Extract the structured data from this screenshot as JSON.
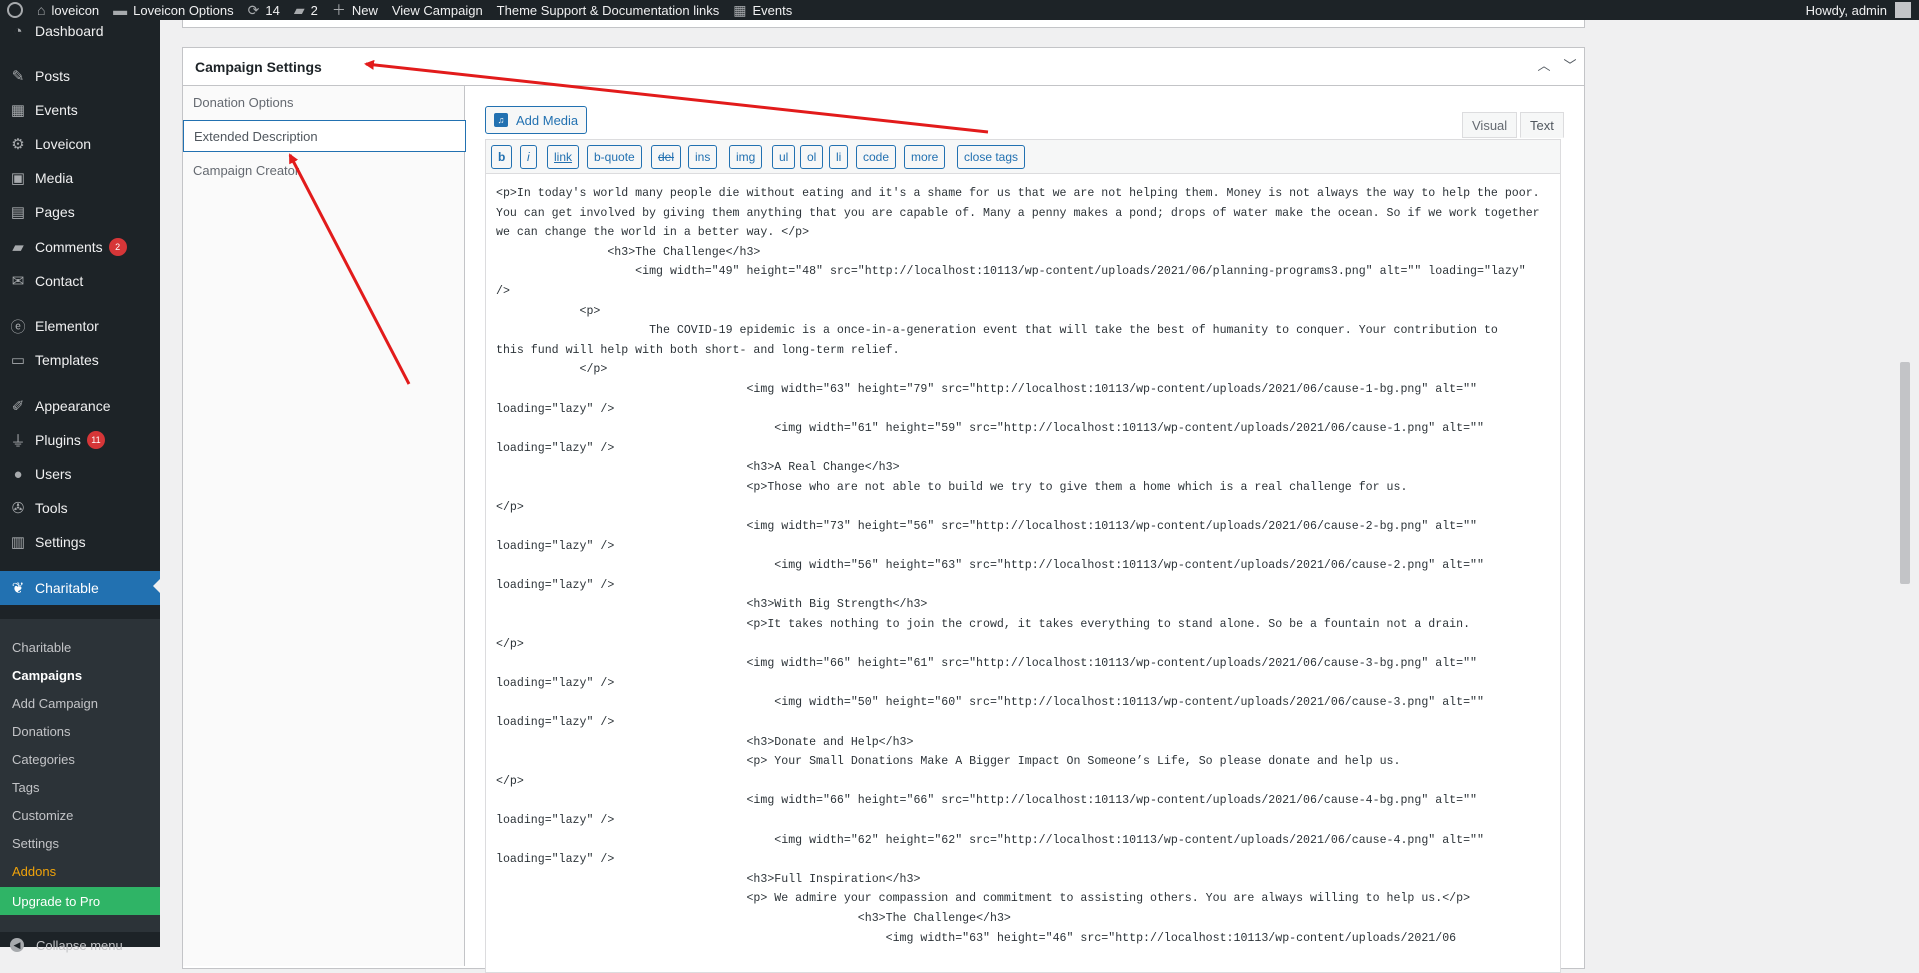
{
  "admin_bar": {
    "site_name": "loveicon",
    "options": "Loveicon Options",
    "updates_count": "14",
    "comments_count": "2",
    "new_label": "New",
    "view_campaign": "View Campaign",
    "theme_support": "Theme Support & Documentation links",
    "events": "Events",
    "howdy": "Howdy, admin"
  },
  "sidebar": {
    "items": [
      {
        "label": "Dashboard",
        "icon": "dashboard-icon"
      },
      {
        "label": "Posts",
        "icon": "pin-icon"
      },
      {
        "label": "Events",
        "icon": "calendar-icon"
      },
      {
        "label": "Loveicon",
        "icon": "gear-icon"
      },
      {
        "label": "Media",
        "icon": "media-icon"
      },
      {
        "label": "Pages",
        "icon": "page-icon"
      },
      {
        "label": "Comments",
        "icon": "comment-icon",
        "badge": "2"
      },
      {
        "label": "Contact",
        "icon": "mail-icon"
      },
      {
        "label": "Elementor",
        "icon": "elementor-icon"
      },
      {
        "label": "Templates",
        "icon": "folder-icon"
      },
      {
        "label": "Appearance",
        "icon": "brush-icon"
      },
      {
        "label": "Plugins",
        "icon": "plugin-icon",
        "badge": "11"
      },
      {
        "label": "Users",
        "icon": "user-icon"
      },
      {
        "label": "Tools",
        "icon": "wrench-icon"
      },
      {
        "label": "Settings",
        "icon": "settings-icon"
      },
      {
        "label": "Charitable",
        "icon": "charitable-icon"
      }
    ],
    "submenu": [
      "Charitable",
      "Campaigns",
      "Add Campaign",
      "Donations",
      "Categories",
      "Tags",
      "Customize",
      "Settings",
      "Addons"
    ],
    "upgrade": "Upgrade to Pro",
    "collapse": "Collapse menu"
  },
  "metabox": {
    "title": "Campaign Settings",
    "tabs": [
      "Donation Options",
      "Extended Description",
      "Campaign Creator"
    ],
    "selected_tab": "Extended Description"
  },
  "editor": {
    "add_media": "Add Media",
    "visual_tab": "Visual",
    "text_tab": "Text",
    "quicktags": [
      "b",
      "i",
      "link",
      "b-quote",
      "del",
      "ins",
      "img",
      "ul",
      "ol",
      "li",
      "code",
      "more",
      "close tags"
    ],
    "content": "<p>In today's world many people die without eating and it's a shame for us that we are not helping them. Money is not always the way to help the poor.\nYou can get involved by giving them anything that you are capable of. Many a penny makes a pond; drops of water make the ocean. So if we work together\nwe can change the world in a better way. </p>\n                <h3>The Challenge</h3>\n                    <img width=\"49\" height=\"48\" src=\"http://localhost:10113/wp-content/uploads/2021/06/planning-programs3.png\" alt=\"\" loading=\"lazy\"\n/>\n            <p>\n                      The COVID-19 epidemic is a once-in-a-generation event that will take the best of humanity to conquer. Your contribution to\nthis fund will help with both short- and long-term relief.\n            </p>\n                                    <img width=\"63\" height=\"79\" src=\"http://localhost:10113/wp-content/uploads/2021/06/cause-1-bg.png\" alt=\"\"\nloading=\"lazy\" />\n                                        <img width=\"61\" height=\"59\" src=\"http://localhost:10113/wp-content/uploads/2021/06/cause-1.png\" alt=\"\"\nloading=\"lazy\" />\n                                    <h3>A Real Change</h3>\n                                    <p>Those who are not able to build we try to give them a home which is a real challenge for us.\n</p>\n                                    <img width=\"73\" height=\"56\" src=\"http://localhost:10113/wp-content/uploads/2021/06/cause-2-bg.png\" alt=\"\"\nloading=\"lazy\" />\n                                        <img width=\"56\" height=\"63\" src=\"http://localhost:10113/wp-content/uploads/2021/06/cause-2.png\" alt=\"\"\nloading=\"lazy\" />\n                                    <h3>With Big Strength</h3>\n                                    <p>It takes nothing to join the crowd, it takes everything to stand alone. So be a fountain not a drain.\n</p>\n                                    <img width=\"66\" height=\"61\" src=\"http://localhost:10113/wp-content/uploads/2021/06/cause-3-bg.png\" alt=\"\"\nloading=\"lazy\" />\n                                        <img width=\"50\" height=\"60\" src=\"http://localhost:10113/wp-content/uploads/2021/06/cause-3.png\" alt=\"\"\nloading=\"lazy\" />\n                                    <h3>Donate and Help</h3>\n                                    <p> Your Small Donations Make A Bigger Impact On Someone’s Life, So please donate and help us.\n</p>\n                                    <img width=\"66\" height=\"66\" src=\"http://localhost:10113/wp-content/uploads/2021/06/cause-4-bg.png\" alt=\"\"\nloading=\"lazy\" />\n                                        <img width=\"62\" height=\"62\" src=\"http://localhost:10113/wp-content/uploads/2021/06/cause-4.png\" alt=\"\"\nloading=\"lazy\" />\n                                    <h3>Full Inspiration</h3>\n                                    <p> We admire your compassion and commitment to assisting others. You are always willing to help us.</p>\n                                                    <h3>The Challenge</h3>\n                                                        <img width=\"63\" height=\"46\" src=\"http://localhost:10113/wp-content/uploads/2021/06"
  },
  "colors": {
    "admin_bar": "#1d2327",
    "accent": "#2271b1",
    "annotation_arrow": "#e21b1b",
    "upgrade": "#2fb466"
  }
}
